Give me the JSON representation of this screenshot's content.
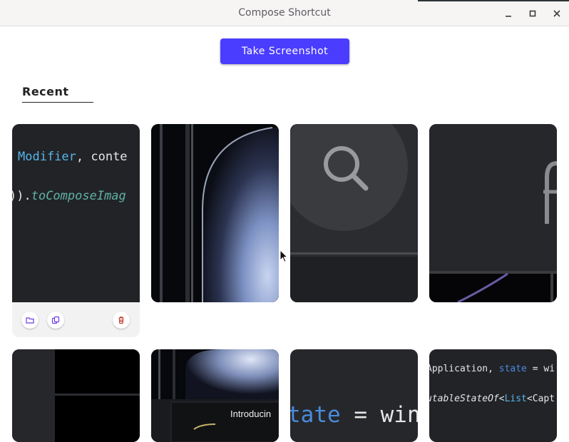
{
  "window": {
    "title": "Compose Shortcut",
    "controls": [
      "minimize-icon",
      "maximize-icon",
      "close-icon"
    ]
  },
  "toolbar": {
    "take_screenshot_label": "Take Screenshot",
    "accent": "#4b3dff"
  },
  "tabs": [
    {
      "label": "Recent",
      "selected": true
    }
  ],
  "thumbnails": [
    {
      "kind": "code",
      "lines": [
        {
          "a": "Modifier",
          "b": ", conte"
        },
        {
          "a": ")).",
          "b": "toComposeImag"
        }
      ],
      "actions": [
        "folder-icon",
        "copy-icon",
        "trash-icon"
      ]
    },
    {
      "kind": "phone-edge"
    },
    {
      "kind": "search-ui"
    },
    {
      "kind": "phone-partial"
    },
    {
      "kind": "dark-panel"
    },
    {
      "kind": "phone-promo",
      "text": "Introducin"
    },
    {
      "kind": "code-large",
      "text": {
        "a": "tate",
        "b": " = win"
      }
    },
    {
      "kind": "code",
      "lines": [
        {
          "a": "Application",
          "b": ", ",
          "c": "state",
          "d": " = wi"
        },
        {
          "a": "utableStateOf",
          "b": "<",
          "c": "List",
          "d": "<Capt"
        }
      ]
    }
  ],
  "colors": {
    "code_type": "#56b6e8",
    "code_fn": "#5fb3a6",
    "code_kw": "#4a8bdc",
    "delete": "#c0392b",
    "action": "#6a3de8"
  }
}
